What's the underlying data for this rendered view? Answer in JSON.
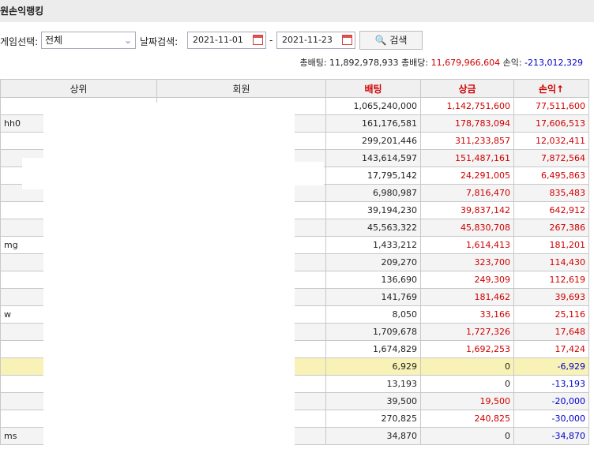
{
  "header": {
    "title": "원손익랭킹"
  },
  "filters": {
    "game_label": "게임선택:",
    "game_value": "전체",
    "date_label": "날짜검색:",
    "date_from": "2021-11-01",
    "date_sep": "-",
    "date_to": "2021-11-23",
    "search_label": "검색"
  },
  "summary": {
    "bet_label": "총배팅:",
    "bet_value": "11,892,978,933",
    "win_label": "총배당:",
    "win_value": "11,679,966,604",
    "profit_label": "손익:",
    "profit_value": "-213,012,329"
  },
  "table": {
    "headers": [
      "상위",
      "회원",
      "배팅",
      "상금",
      "손익↑"
    ],
    "rows": [
      {
        "parent": "",
        "member": "",
        "bet": "1,065,240,000",
        "prize": "1,142,751,600",
        "profit": "77,511,600"
      },
      {
        "parent": "hh0",
        "member": "",
        "bet": "161,176,581",
        "prize": "178,783,094",
        "profit": "17,606,513"
      },
      {
        "parent": "",
        "member": "",
        "bet": "299,201,446",
        "prize": "311,233,857",
        "profit": "12,032,411"
      },
      {
        "parent": "",
        "member": "",
        "bet": "143,614,597",
        "prize": "151,487,161",
        "profit": "7,872,564"
      },
      {
        "parent": "",
        "member": "",
        "bet": "17,795,142",
        "prize": "24,291,005",
        "profit": "6,495,863"
      },
      {
        "parent": "",
        "member": "",
        "bet": "6,980,987",
        "prize": "7,816,470",
        "profit": "835,483"
      },
      {
        "parent": "",
        "member": "",
        "bet": "39,194,230",
        "prize": "39,837,142",
        "profit": "642,912"
      },
      {
        "parent": "",
        "member": "",
        "bet": "45,563,322",
        "prize": "45,830,708",
        "profit": "267,386"
      },
      {
        "parent": "mg",
        "member": "",
        "bet": "1,433,212",
        "prize": "1,614,413",
        "profit": "181,201"
      },
      {
        "parent": "",
        "member": "",
        "bet": "209,270",
        "prize": "323,700",
        "profit": "114,430"
      },
      {
        "parent": "",
        "member": "",
        "bet": "136,690",
        "prize": "249,309",
        "profit": "112,619"
      },
      {
        "parent": "",
        "member": "",
        "bet": "141,769",
        "prize": "181,462",
        "profit": "39,693"
      },
      {
        "parent": "w",
        "member": "",
        "bet": "8,050",
        "prize": "33,166",
        "profit": "25,116"
      },
      {
        "parent": "",
        "member": "",
        "bet": "1,709,678",
        "prize": "1,727,326",
        "profit": "17,648"
      },
      {
        "parent": "",
        "member": "",
        "bet": "1,674,829",
        "prize": "1,692,253",
        "profit": "17,424"
      },
      {
        "parent": "",
        "member": "",
        "bet": "6,929",
        "prize": "0",
        "profit": "-6,929"
      },
      {
        "parent": "",
        "member": "",
        "bet": "13,193",
        "prize": "0",
        "profit": "-13,193"
      },
      {
        "parent": "",
        "member": "",
        "bet": "39,500",
        "prize": "19,500",
        "profit": "-20,000"
      },
      {
        "parent": "",
        "member": "",
        "bet": "270,825",
        "prize": "240,825",
        "profit": "-30,000"
      },
      {
        "parent": "ms",
        "member": "",
        "bet": "34,870",
        "prize": "0",
        "profit": "-34,870"
      }
    ]
  },
  "colors": {
    "positive": "#d00000",
    "negative": "#0000cc",
    "highlight": "#f8f2b6"
  }
}
